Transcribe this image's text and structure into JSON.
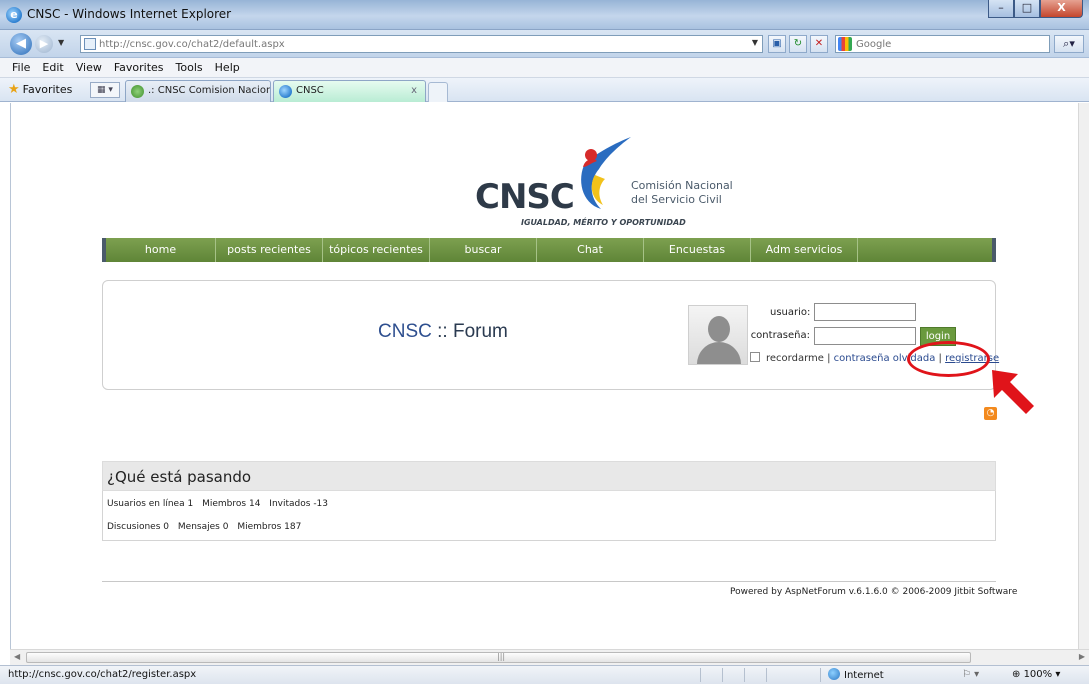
{
  "window": {
    "title": "CNSC - Windows Internet Explorer",
    "buttons": {
      "minimize": "–",
      "maximize": "□",
      "close": "X"
    }
  },
  "address": {
    "url": "http://cnsc.gov.co/chat2/default.aspx",
    "search_placeholder": "Google"
  },
  "menu": [
    "File",
    "Edit",
    "View",
    "Favorites",
    "Tools",
    "Help"
  ],
  "favorites": {
    "label": "Favorites",
    "tabs": [
      {
        "label": ".: CNSC Comision Nacion..."
      },
      {
        "label": "CNSC",
        "close": "x"
      }
    ]
  },
  "status": {
    "url": "http://cnsc.gov.co/chat2/register.aspx",
    "zone": "Internet",
    "zoom": "100%"
  },
  "logo": {
    "text": "CNSC",
    "sub1": "Comisión Nacional",
    "sub2": "del Servicio Civil",
    "slogan": "IGUALDAD, MÉRITO Y OPORTUNIDAD"
  },
  "nav": [
    "home",
    "posts recientes",
    "tópicos recientes",
    "buscar",
    "Chat",
    "Encuestas",
    "Adm servicios"
  ],
  "forum": {
    "title_brand": "CNSC",
    "title_rest": " :: Forum"
  },
  "login": {
    "user_label": "usuario:",
    "pass_label": "contraseña:",
    "button": "login",
    "remember": "recordarme",
    "forgot": "contraseña olvidada",
    "separator": "|",
    "register": "registrarse"
  },
  "happening": {
    "title": "¿Qué está pasando",
    "line1": {
      "online_label": "Usuarios en línea",
      "online": "1",
      "members_label": "Miembros",
      "members": "14",
      "guests_label": "Invitados",
      "guests": "-13"
    },
    "line2": {
      "disc_label": "Discusiones",
      "disc": "0",
      "msg_label": "Mensajes",
      "msg": "0",
      "members_label": "Miembros",
      "members": "187"
    }
  },
  "footer": "Powered by AspNetForum v.6.1.6.0 © 2006-2009 Jitbit Software",
  "colors": {
    "nav_green": "#6b9142",
    "highlight_red": "#e0141a",
    "link_blue": "#2a4a8f"
  }
}
